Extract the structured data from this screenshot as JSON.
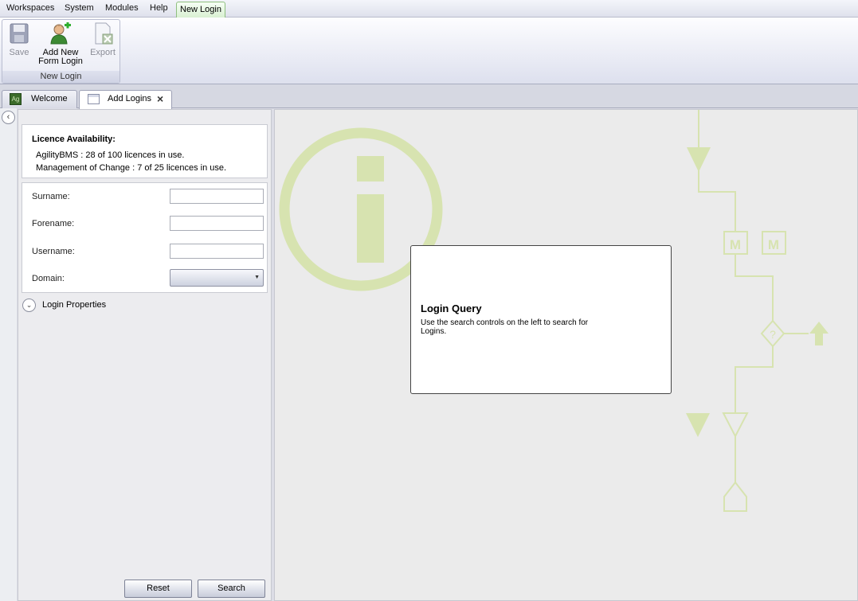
{
  "menu": {
    "items": [
      "Workspaces",
      "System",
      "Modules",
      "Help"
    ],
    "active": "New Login"
  },
  "ribbon": {
    "save": "Save",
    "add_new_line1": "Add New",
    "add_new_line2": "Form Login",
    "export": "Export",
    "group_label": "New Login"
  },
  "tabs": {
    "welcome": "Welcome",
    "welcome_icon_text": "Ag",
    "add_logins": "Add Logins",
    "close": "×"
  },
  "licence": {
    "title": "Licence Availability:",
    "line1": "AgilityBMS :  28 of 100 licences in use.",
    "line2": "Management of Change :  7 of 25 licences in use."
  },
  "form": {
    "surname_label": "Surname:",
    "surname_value": "",
    "forename_label": "Forename:",
    "forename_value": "",
    "username_label": "Username:",
    "username_value": "",
    "domain_label": "Domain:",
    "domain_value": ""
  },
  "login_properties": "Login Properties",
  "buttons": {
    "reset": "Reset",
    "search": "Search"
  },
  "query": {
    "title": "Login Query",
    "desc_line1": "Use the search controls on the left to search for",
    "desc_line2": "Logins."
  },
  "watermark": {
    "m1": "M",
    "m2": "M",
    "q": "?"
  },
  "colors": {
    "accent_green": "#d7e3b0",
    "active_tab_green": "#d9f0d2"
  }
}
